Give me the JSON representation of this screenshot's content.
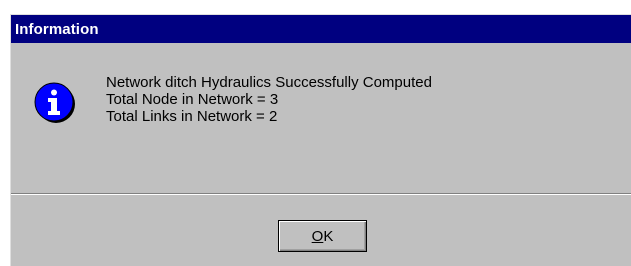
{
  "dialog": {
    "title": "Information",
    "icon": "information-icon",
    "message_lines": [
      "Network ditch Hydraulics Successfully Computed",
      "Total Node in Network = 3",
      "Total Links in Network = 2"
    ],
    "ok_label": "OK"
  },
  "colors": {
    "titlebar": "#000080",
    "face": "#c0c0c0",
    "icon_blue": "#0000ff"
  }
}
